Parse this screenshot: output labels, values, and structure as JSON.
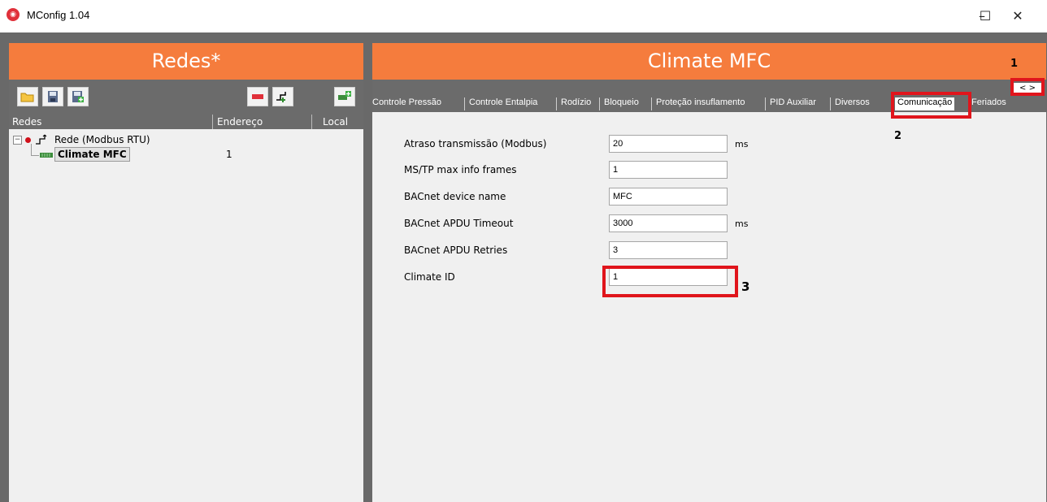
{
  "window": {
    "title": "MConfig 1.04",
    "app_icon": "mconfig-logo",
    "controls": {
      "minimize": "–",
      "maximize": "☐",
      "close": "✕"
    }
  },
  "left_panel": {
    "header": "Redes*",
    "toolbar_icons": [
      "open-folder-icon",
      "save-icon",
      "save-as-icon",
      "remove-icon",
      "add-network-icon",
      "add-device-icon"
    ],
    "columns": {
      "name": "Redes",
      "address": "Endereço",
      "local": "Local"
    },
    "tree": {
      "network_label": "Rede (Modbus RTU)",
      "device_label": "Climate MFC",
      "device_address": "1"
    }
  },
  "right_panel": {
    "header": "Climate MFC",
    "tabs": [
      "Controle Pressão",
      "Controle Entalpia",
      "Rodízio",
      "Bloqueio",
      "Proteção insuflamento",
      "PID Auxiliar",
      "Diversos",
      "Comunicação",
      "Feriados"
    ],
    "active_tab": "Comunicação",
    "scroll_arrows": "< >",
    "fields": [
      {
        "label": "Atraso transmissão (Modbus)",
        "value": "20",
        "unit": "ms"
      },
      {
        "label": "MS/TP max info frames",
        "value": "1",
        "unit": ""
      },
      {
        "label": "BACnet device name",
        "value": "MFC",
        "unit": ""
      },
      {
        "label": "BACnet APDU Timeout",
        "value": "3000",
        "unit": "ms"
      },
      {
        "label": "BACnet APDU Retries",
        "value": "3",
        "unit": ""
      },
      {
        "label": "Climate ID",
        "value": "1",
        "unit": ""
      }
    ]
  },
  "annotations": {
    "n1": "1",
    "n2": "2",
    "n3": "3",
    "color": "#e0151c"
  },
  "colors": {
    "header": "#f57c3d",
    "frame": "#696969"
  }
}
